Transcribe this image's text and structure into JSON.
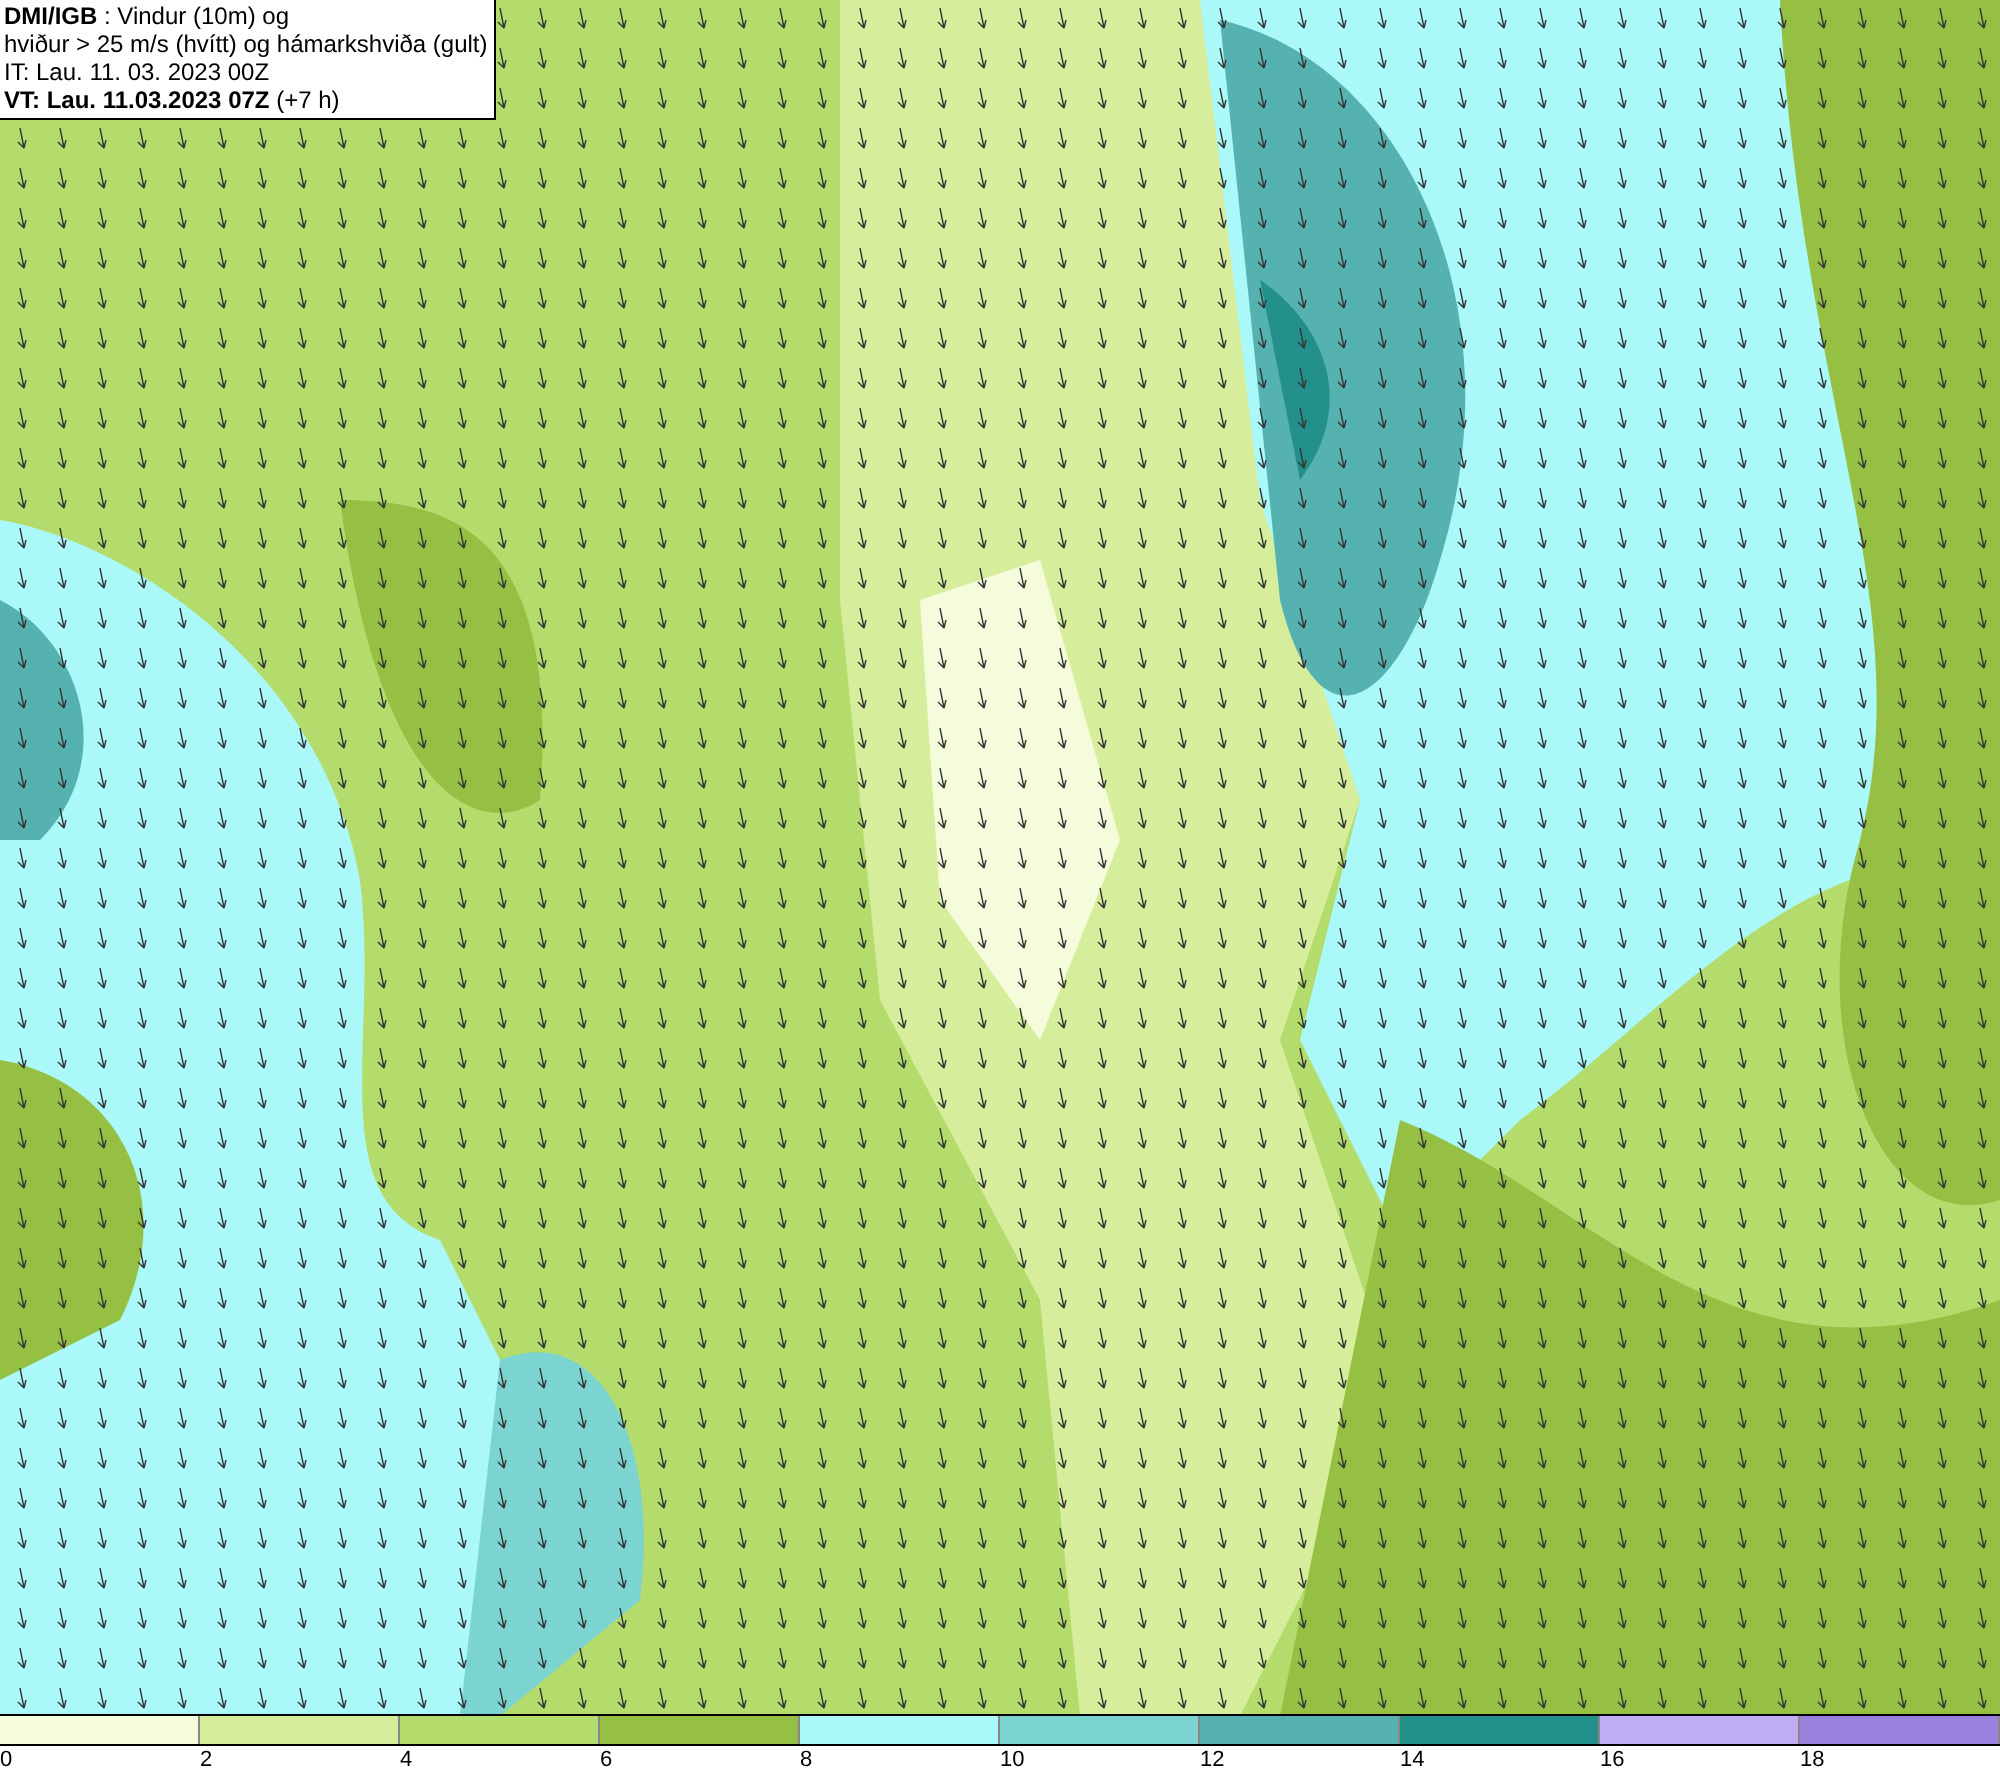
{
  "info_box": {
    "lines": [
      "**DMI/IGB** : Vindur (10m) og",
      "hviður > 25 m/s (hvítt) og hámarkshviða (gult)",
      "IT: Lau. 11. 03. 2023 00Z",
      "**VT: Lau. 11.03.2023 07Z** (+7 h)"
    ]
  },
  "legend": [
    {
      "label": "0",
      "color": "#f4fcdc"
    },
    {
      "label": "2",
      "color": "#d6ee9c"
    },
    {
      "label": "4",
      "color": "#b4dc6c"
    },
    {
      "label": "6",
      "color": "#96c044"
    },
    {
      "label": "8",
      "color": "#aaf8f8"
    },
    {
      "label": "10",
      "color": "#7cd4d0"
    },
    {
      "label": "12",
      "color": "#56b2b0"
    },
    {
      "label": "14",
      "color": "#24908c"
    },
    {
      "label": "16",
      "color": "#c0aef4"
    },
    {
      "label": "18",
      "color": "#9880dc"
    }
  ]
}
